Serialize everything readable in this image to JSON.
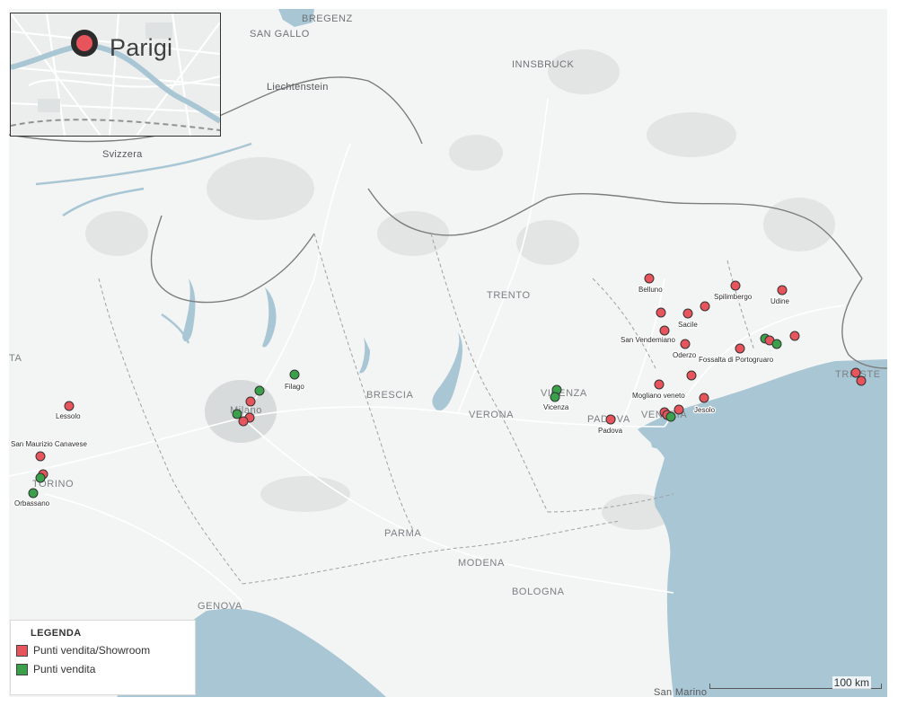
{
  "inset": {
    "city": "Parigi"
  },
  "places": {
    "bregenz": "BREGENZ",
    "san_gallo": "SAN GALLO",
    "innsbruck": "INNSBRUCK",
    "liechtenstein": "Liechtenstein",
    "svizzera": "Svizzera",
    "trento": "TRENTO",
    "brescia": "BRESCIA",
    "verona": "VERONA",
    "vicenza_city": "VICENZA",
    "padova_city": "PADOVA",
    "venezia_city": "VENEZIA",
    "trieste_city": "TRIESTE",
    "torino": "TORINO",
    "milano": "Milano",
    "parma": "PARMA",
    "modena": "MODENA",
    "bologna": "BOLOGNA",
    "genova": "GENOVA",
    "san_marino": "San Marino",
    "ta": "TA"
  },
  "labels": {
    "belluno": "Belluno",
    "spilimbergo": "Spilimbergo",
    "udine": "Udine",
    "sacile": "Sacile",
    "san_vendemiano": "San Vendemiano",
    "oderzo": "Oderzo",
    "fossalta": "Fossalta di Portogruaro",
    "mogliano": "Mogliano veneto",
    "jesolo": "Jesolo",
    "vicenza": "Vicenza",
    "padova": "Padova",
    "filago": "Filago",
    "lessolo": "Lessolo",
    "san_maurizio": "San Maurizio Canavese",
    "orbassano": "Orbassano"
  },
  "legend": {
    "title": "LEGENDA",
    "items": [
      {
        "label": "Punti vendita/Showroom",
        "color": "#e8545c"
      },
      {
        "label": "Punti vendita",
        "color": "#3aa04a"
      }
    ]
  },
  "scale": {
    "label": "100 km"
  },
  "colors": {
    "showroom": "#e8545c",
    "store": "#3aa04a",
    "water": "#a9c6d4",
    "land": "#f2f3f3"
  }
}
